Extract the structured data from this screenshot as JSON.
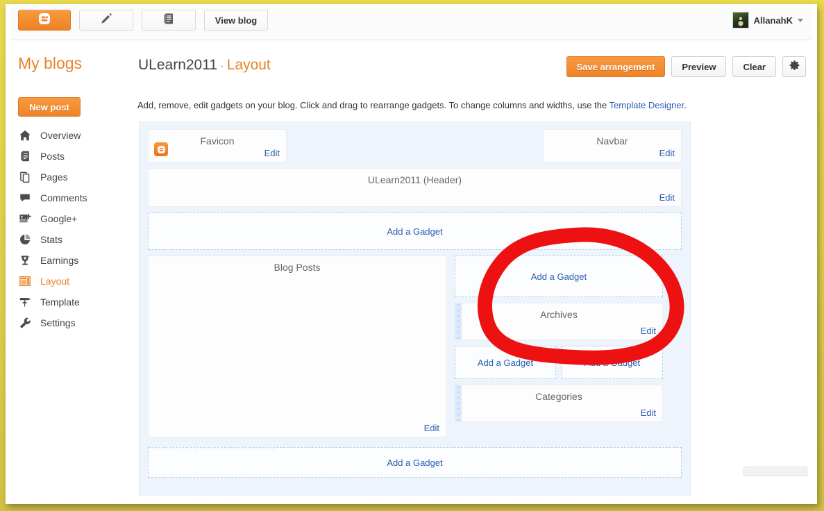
{
  "topbar": {
    "logo_icon": "blogger-logo-icon",
    "new_post_pencil_icon": "pencil-icon",
    "all_posts_icon": "document-list-icon",
    "view_blog_label": "View blog",
    "user_name": "AllanahK",
    "user_caret_icon": "chevron-down-icon"
  },
  "pagehead": {
    "my_blogs_label": "My blogs",
    "blog_name": "ULearn2011",
    "separator": "·",
    "current_section": "Layout",
    "save_label": "Save arrangement",
    "preview_label": "Preview",
    "clear_label": "Clear",
    "settings_icon": "gear-icon"
  },
  "sidebar": {
    "new_post_label": "New post",
    "items": [
      {
        "label": "Overview",
        "icon": "home-icon",
        "active": false
      },
      {
        "label": "Posts",
        "icon": "posts-icon",
        "active": false
      },
      {
        "label": "Pages",
        "icon": "pages-icon",
        "active": false
      },
      {
        "label": "Comments",
        "icon": "comment-icon",
        "active": false
      },
      {
        "label": "Google+",
        "icon": "google-plus-icon",
        "active": false
      },
      {
        "label": "Stats",
        "icon": "pie-chart-icon",
        "active": false
      },
      {
        "label": "Earnings",
        "icon": "trophy-icon",
        "active": false
      },
      {
        "label": "Layout",
        "icon": "layout-icon",
        "active": true
      },
      {
        "label": "Template",
        "icon": "paint-roller-icon",
        "active": false
      },
      {
        "label": "Settings",
        "icon": "wrench-icon",
        "active": false
      }
    ]
  },
  "content": {
    "description_prefix": "Add, remove, edit gadgets on your blog. Click and drag to rearrange gadgets. To change columns and widths, use the ",
    "description_link": "Template Designer",
    "description_suffix": ".",
    "edit_label": "Edit",
    "add_gadget_label": "Add a Gadget",
    "gadgets": {
      "favicon": "Favicon",
      "navbar": "Navbar",
      "header": "ULearn2011 (Header)",
      "blog_posts": "Blog Posts",
      "archives": "Archives",
      "categories": "Categories"
    },
    "watermark": "wwwwww | a great html template sample"
  },
  "annotation": {
    "type": "hand-drawn-red-circle",
    "color": "#ee1111",
    "encircles": "add-a-gadget-sidebar-top"
  },
  "colors": {
    "brand_orange": "#e8832a",
    "link_blue": "#2a5db0",
    "canvas_blue": "#edf4fb",
    "frame_gold": "#ded04b",
    "annotation_red": "#ee1111"
  }
}
